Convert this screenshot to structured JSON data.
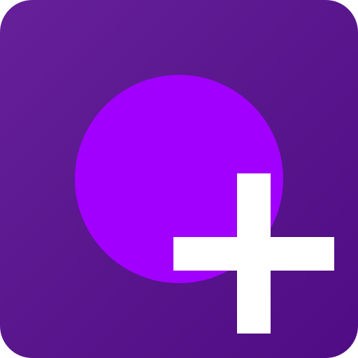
{
  "icon": {
    "name": "plus-app-icon",
    "symbol": "plus-icon",
    "colors": {
      "background_start": "#66219a",
      "background_end": "#4f0c84",
      "circle": "#a100ff",
      "plus": "#ffffff"
    }
  }
}
